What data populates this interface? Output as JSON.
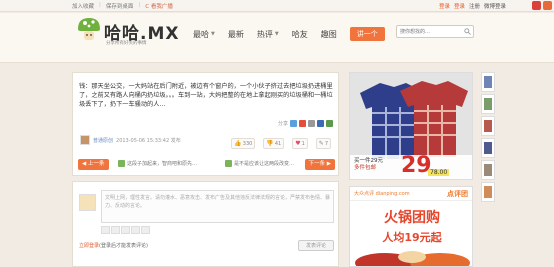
{
  "topbar": {
    "links": [
      "加入收藏",
      "保存到桌面",
      "C 看我广播"
    ],
    "user": [
      "登录",
      "登录",
      "注册",
      "微博登录"
    ]
  },
  "header": {
    "logo_text": "哈哈.MX",
    "logo_sub": "分享所有好笑的事情",
    "nav": [
      {
        "label": "最哈",
        "has_caret": true
      },
      {
        "label": "最新",
        "has_caret": false
      },
      {
        "label": "热评",
        "has_caret": true
      },
      {
        "label": "哈友",
        "has_caret": false
      },
      {
        "label": "趣图",
        "has_caret": false
      }
    ],
    "post_button": "讲一个",
    "search_placeholder": "搜你想找的…"
  },
  "post": {
    "content": "钱：那天坐公交，一大妈站在后门附近，被边有个窗户的，一个小伙子挤过去把垃圾扔进桶里了，之前又有路人向桶内扔垃圾。。。车到一站，大妈把整的在地上拿起刚买的垃圾桶和一桶垃圾丢下了，扔下一车骚动的人…",
    "tools": [
      "分享",
      "QQ",
      "微博",
      "复制",
      "人人",
      "豆瓣"
    ],
    "author": "普通原创",
    "time": "2013-05-06 15:33:42 发布",
    "actions": [
      {
        "icon": "thumbs-up-icon",
        "count": "330"
      },
      {
        "icon": "thumbs-down-icon",
        "count": "41"
      },
      {
        "icon": "heart-icon",
        "count": "1"
      },
      {
        "icon": "comment-icon",
        "count": "7"
      }
    ],
    "prev_label": "上一条",
    "prev_text": "这段子加起来，智商吧和原先…",
    "next_text": "是不是应该让这两段改变…",
    "next_label": "下一条"
  },
  "comment": {
    "placeholder": "文明上网，理性发言。请勿灌水、恶意攻击、发布广告及其他违反法律法规的言论，严禁发布色情、暴力、反动的言论。",
    "login_label": "立即登录",
    "login_hint": "(登录后才能发表评论)",
    "submit_label": "发表评论"
  },
  "ads": {
    "shirt_price": "29",
    "shirt_line1": "买一件29元",
    "shirt_line2": "多件包邮",
    "shirt_total": "78.00",
    "hotpot_brand": "大众点评 dianping.com",
    "hotpot_tag": "点评团",
    "hotpot_title": "火锅团购",
    "hotpot_price": "人均19元起"
  },
  "colors": {
    "accent": "#f0743c",
    "link": "#e35b2c",
    "bg": "#f1ebe3"
  }
}
